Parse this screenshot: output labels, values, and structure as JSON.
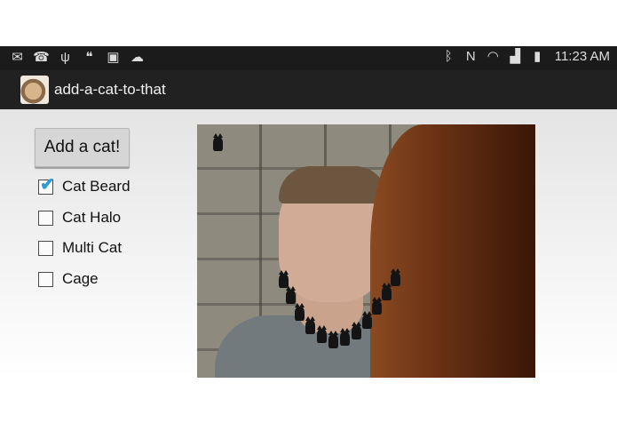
{
  "status_bar": {
    "left_icons": [
      "mail-icon",
      "missed-call-icon",
      "usb-icon",
      "hangouts-icon",
      "gallery-icon",
      "cloud-check-icon"
    ],
    "right_icons": [
      "bluetooth-icon",
      "nfc-icon",
      "wifi-icon",
      "signal-icon",
      "battery-icon"
    ],
    "time": "11:23 AM"
  },
  "action_bar": {
    "app_icon": "hamster-app-icon",
    "title": "add-a-cat-to-that"
  },
  "controls": {
    "add_button_label": "Add a cat!",
    "options": [
      {
        "label": "Cat Beard",
        "checked": true
      },
      {
        "label": "Cat Halo",
        "checked": false
      },
      {
        "label": "Multi Cat",
        "checked": false
      },
      {
        "label": "Cage",
        "checked": false
      }
    ]
  },
  "photo": {
    "description_icon": "selfie-photo-with-cat-beard"
  }
}
